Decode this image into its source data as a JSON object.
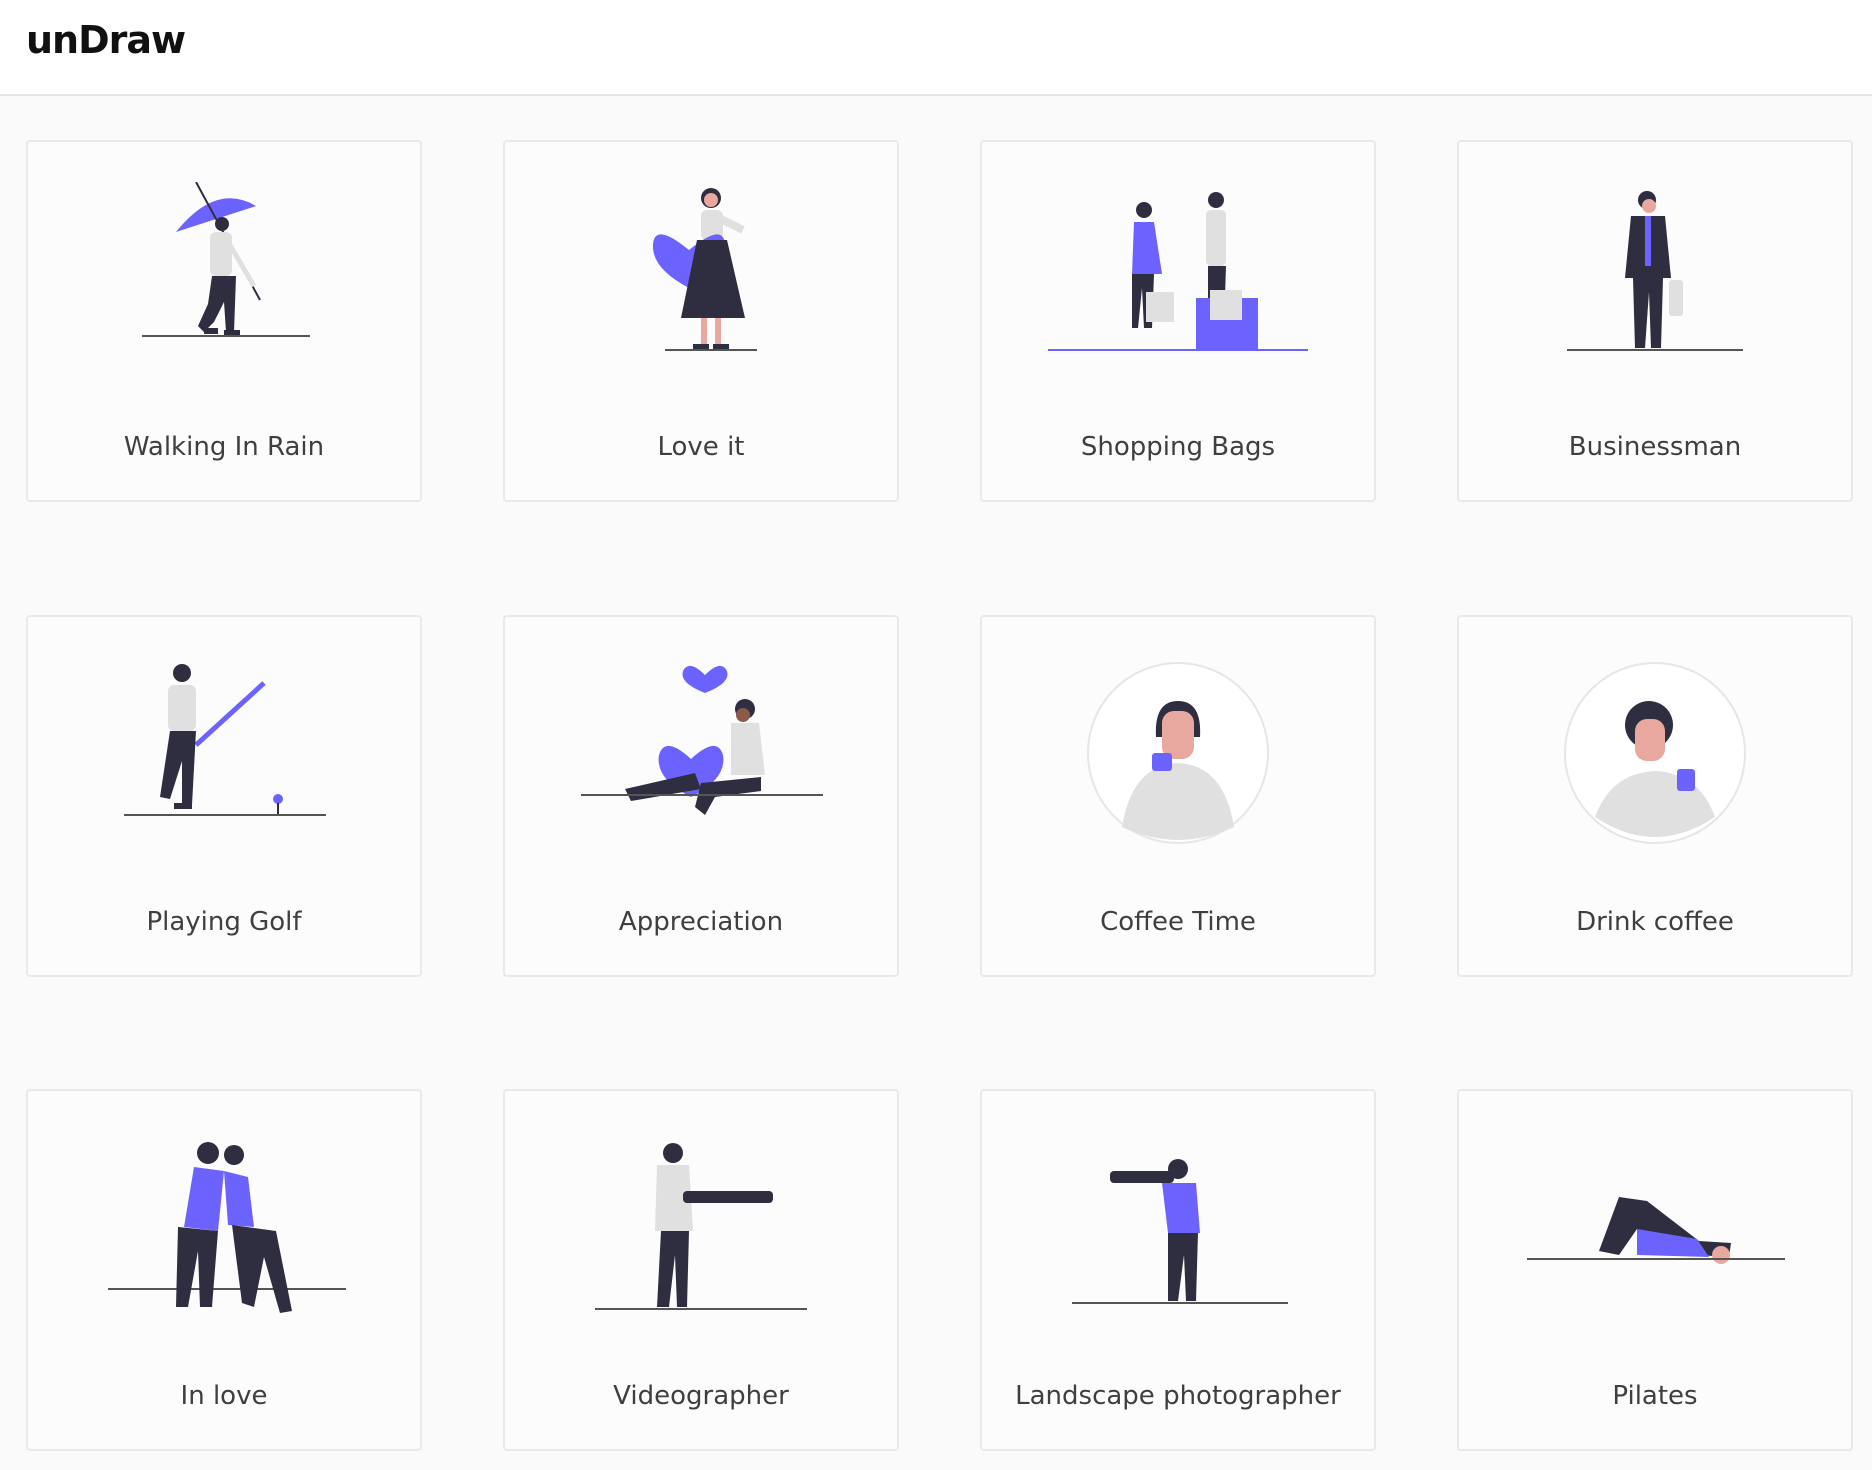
{
  "header": {
    "logo": "unDraw"
  },
  "colors": {
    "accent": "#6c63ff",
    "dark": "#2f2e41",
    "light": "#e0e0e0",
    "skin": "#e8a8a0",
    "hair": "#2a2a35"
  },
  "cards": [
    {
      "title": "Walking In Rain",
      "illustration": "walking-in-rain-illustration"
    },
    {
      "title": "Love it",
      "illustration": "love-it-illustration"
    },
    {
      "title": "Shopping Bags",
      "illustration": "shopping-bags-illustration"
    },
    {
      "title": "Businessman",
      "illustration": "businessman-illustration"
    },
    {
      "title": "Playing Golf",
      "illustration": "playing-golf-illustration"
    },
    {
      "title": "Appreciation",
      "illustration": "appreciation-illustration"
    },
    {
      "title": "Coffee Time",
      "illustration": "coffee-time-illustration"
    },
    {
      "title": "Drink coffee",
      "illustration": "drink-coffee-illustration"
    },
    {
      "title": "In love",
      "illustration": "in-love-illustration"
    },
    {
      "title": "Videographer",
      "illustration": "videographer-illustration"
    },
    {
      "title": "Landscape photographer",
      "illustration": "landscape-photographer-illustration"
    },
    {
      "title": "Pilates",
      "illustration": "pilates-illustration"
    }
  ]
}
